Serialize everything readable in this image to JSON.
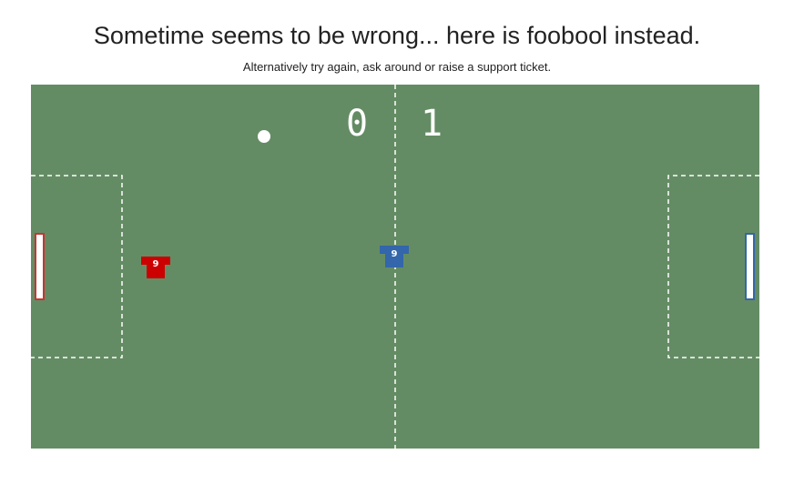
{
  "header": {
    "title": "Sometime seems to be wrong... here is foobool instead.",
    "subtitle": "Alternatively try again, ask around or raise a support ticket."
  },
  "game": {
    "score": {
      "left": "0",
      "right": "1"
    },
    "players": {
      "red": {
        "number": "9",
        "color": "#cc0000"
      },
      "blue": {
        "number": "9",
        "color": "#3366aa"
      }
    },
    "colors": {
      "pitch": "#648c64",
      "lines": "#ffffff",
      "left_goal": "#cc3333",
      "right_goal": "#3366aa",
      "ball": "#ffffff"
    }
  }
}
